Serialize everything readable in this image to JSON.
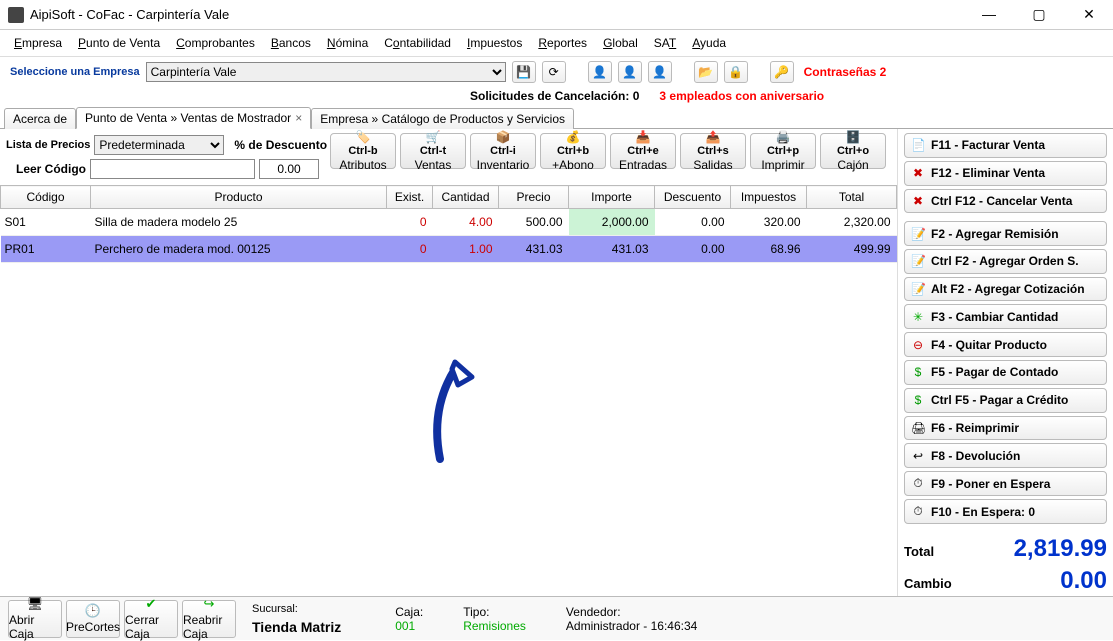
{
  "window": {
    "title": "AipiSoft - CoFac - Carpintería Vale"
  },
  "menu": {
    "empresa": "Empresa",
    "pdv": "Punto de Venta",
    "comp": "Comprobantes",
    "bancos": "Bancos",
    "nomina": "Nómina",
    "cont": "Contabilidad",
    "imp": "Impuestos",
    "rep": "Reportes",
    "global": "Global",
    "sat": "SAT",
    "ayuda": "Ayuda"
  },
  "toolbar": {
    "seleccione": "Seleccione una Empresa",
    "empresa": "Carpintería Vale",
    "contrasenas": "Contraseñas 2",
    "solic": "Solicitudes de Cancelación: 0",
    "anniv": "3 empleados con aniversario"
  },
  "tabs": {
    "t0": "Acerca de",
    "t1": "Punto de Venta » Ventas de Mostrador",
    "t2": "Empresa » Catálogo de Productos y Servicios"
  },
  "filters": {
    "lista": "Lista de Precios",
    "listasel": "Predeterminada",
    "pct": "% de Descuento",
    "leer": "Leer Código",
    "disc": "0.00"
  },
  "ctrl": {
    "b": {
      "k": "Ctrl-b",
      "l": "Atributos"
    },
    "t": {
      "k": "Ctrl-t",
      "l": "Ventas"
    },
    "i": {
      "k": "Ctrl-i",
      "l": "Inventario"
    },
    "pb": {
      "k": "Ctrl+b",
      "l": "+Abono"
    },
    "e": {
      "k": "Ctrl+e",
      "l": "Entradas"
    },
    "s": {
      "k": "Ctrl+s",
      "l": "Salidas"
    },
    "p": {
      "k": "Ctrl+p",
      "l": "Imprimir"
    },
    "o": {
      "k": "Ctrl+o",
      "l": "Cajón"
    }
  },
  "cols": {
    "cod": "Código",
    "prod": "Producto",
    "ex": "Exist.",
    "cant": "Cantidad",
    "prec": "Precio",
    "imp": "Importe",
    "desc": "Descuento",
    "impu": "Impuestos",
    "tot": "Total"
  },
  "rows": [
    {
      "cod": "S01",
      "prod": "Silla de madera modelo 25",
      "ex": "0",
      "cant": "4.00",
      "prec": "500.00",
      "imp": "2,000.00",
      "desc": "0.00",
      "impu": "320.00",
      "tot": "2,320.00"
    },
    {
      "cod": "PR01",
      "prod": "Perchero de madera mod. 00125",
      "ex": "0",
      "cant": "1.00",
      "prec": "431.03",
      "imp": "431.03",
      "desc": "0.00",
      "impu": "68.96",
      "tot": "499.99"
    }
  ],
  "sidebtns": {
    "f11": "F11 - Facturar Venta",
    "f12": "F12 - Eliminar Venta",
    "cf12": "Ctrl F12 - Cancelar Venta",
    "f2": "F2 - Agregar Remisión",
    "cf2": "Ctrl F2 - Agregar Orden S.",
    "af2": "Alt F2 - Agregar Cotización",
    "f3": "F3 - Cambiar Cantidad",
    "f4": "F4 - Quitar Producto",
    "f5": "F5 - Pagar de Contado",
    "cf5": "Ctrl F5 - Pagar a Crédito",
    "f6": "F6 - Reimprimir",
    "f8": "F8 - Devolución",
    "f9": "F9 - Poner en Espera",
    "f10": "F10 - En Espera: 0"
  },
  "totals": {
    "tlab": "Total",
    "tval": "2,819.99",
    "clab": "Cambio",
    "cval": "0.00"
  },
  "status": {
    "abrir": "Abrir Caja",
    "prec": "PreCortes",
    "cerrar": "Cerrar Caja",
    "reab": "Reabrir Caja",
    "suc_l": "Sucursal:",
    "suc": "Tienda Matriz",
    "caja_l": "Caja:",
    "caja": "001",
    "tipo_l": "Tipo:",
    "tipo": "Remisiones",
    "vend_l": "Vendedor:",
    "vend": "Administrador - 16:46:34"
  }
}
